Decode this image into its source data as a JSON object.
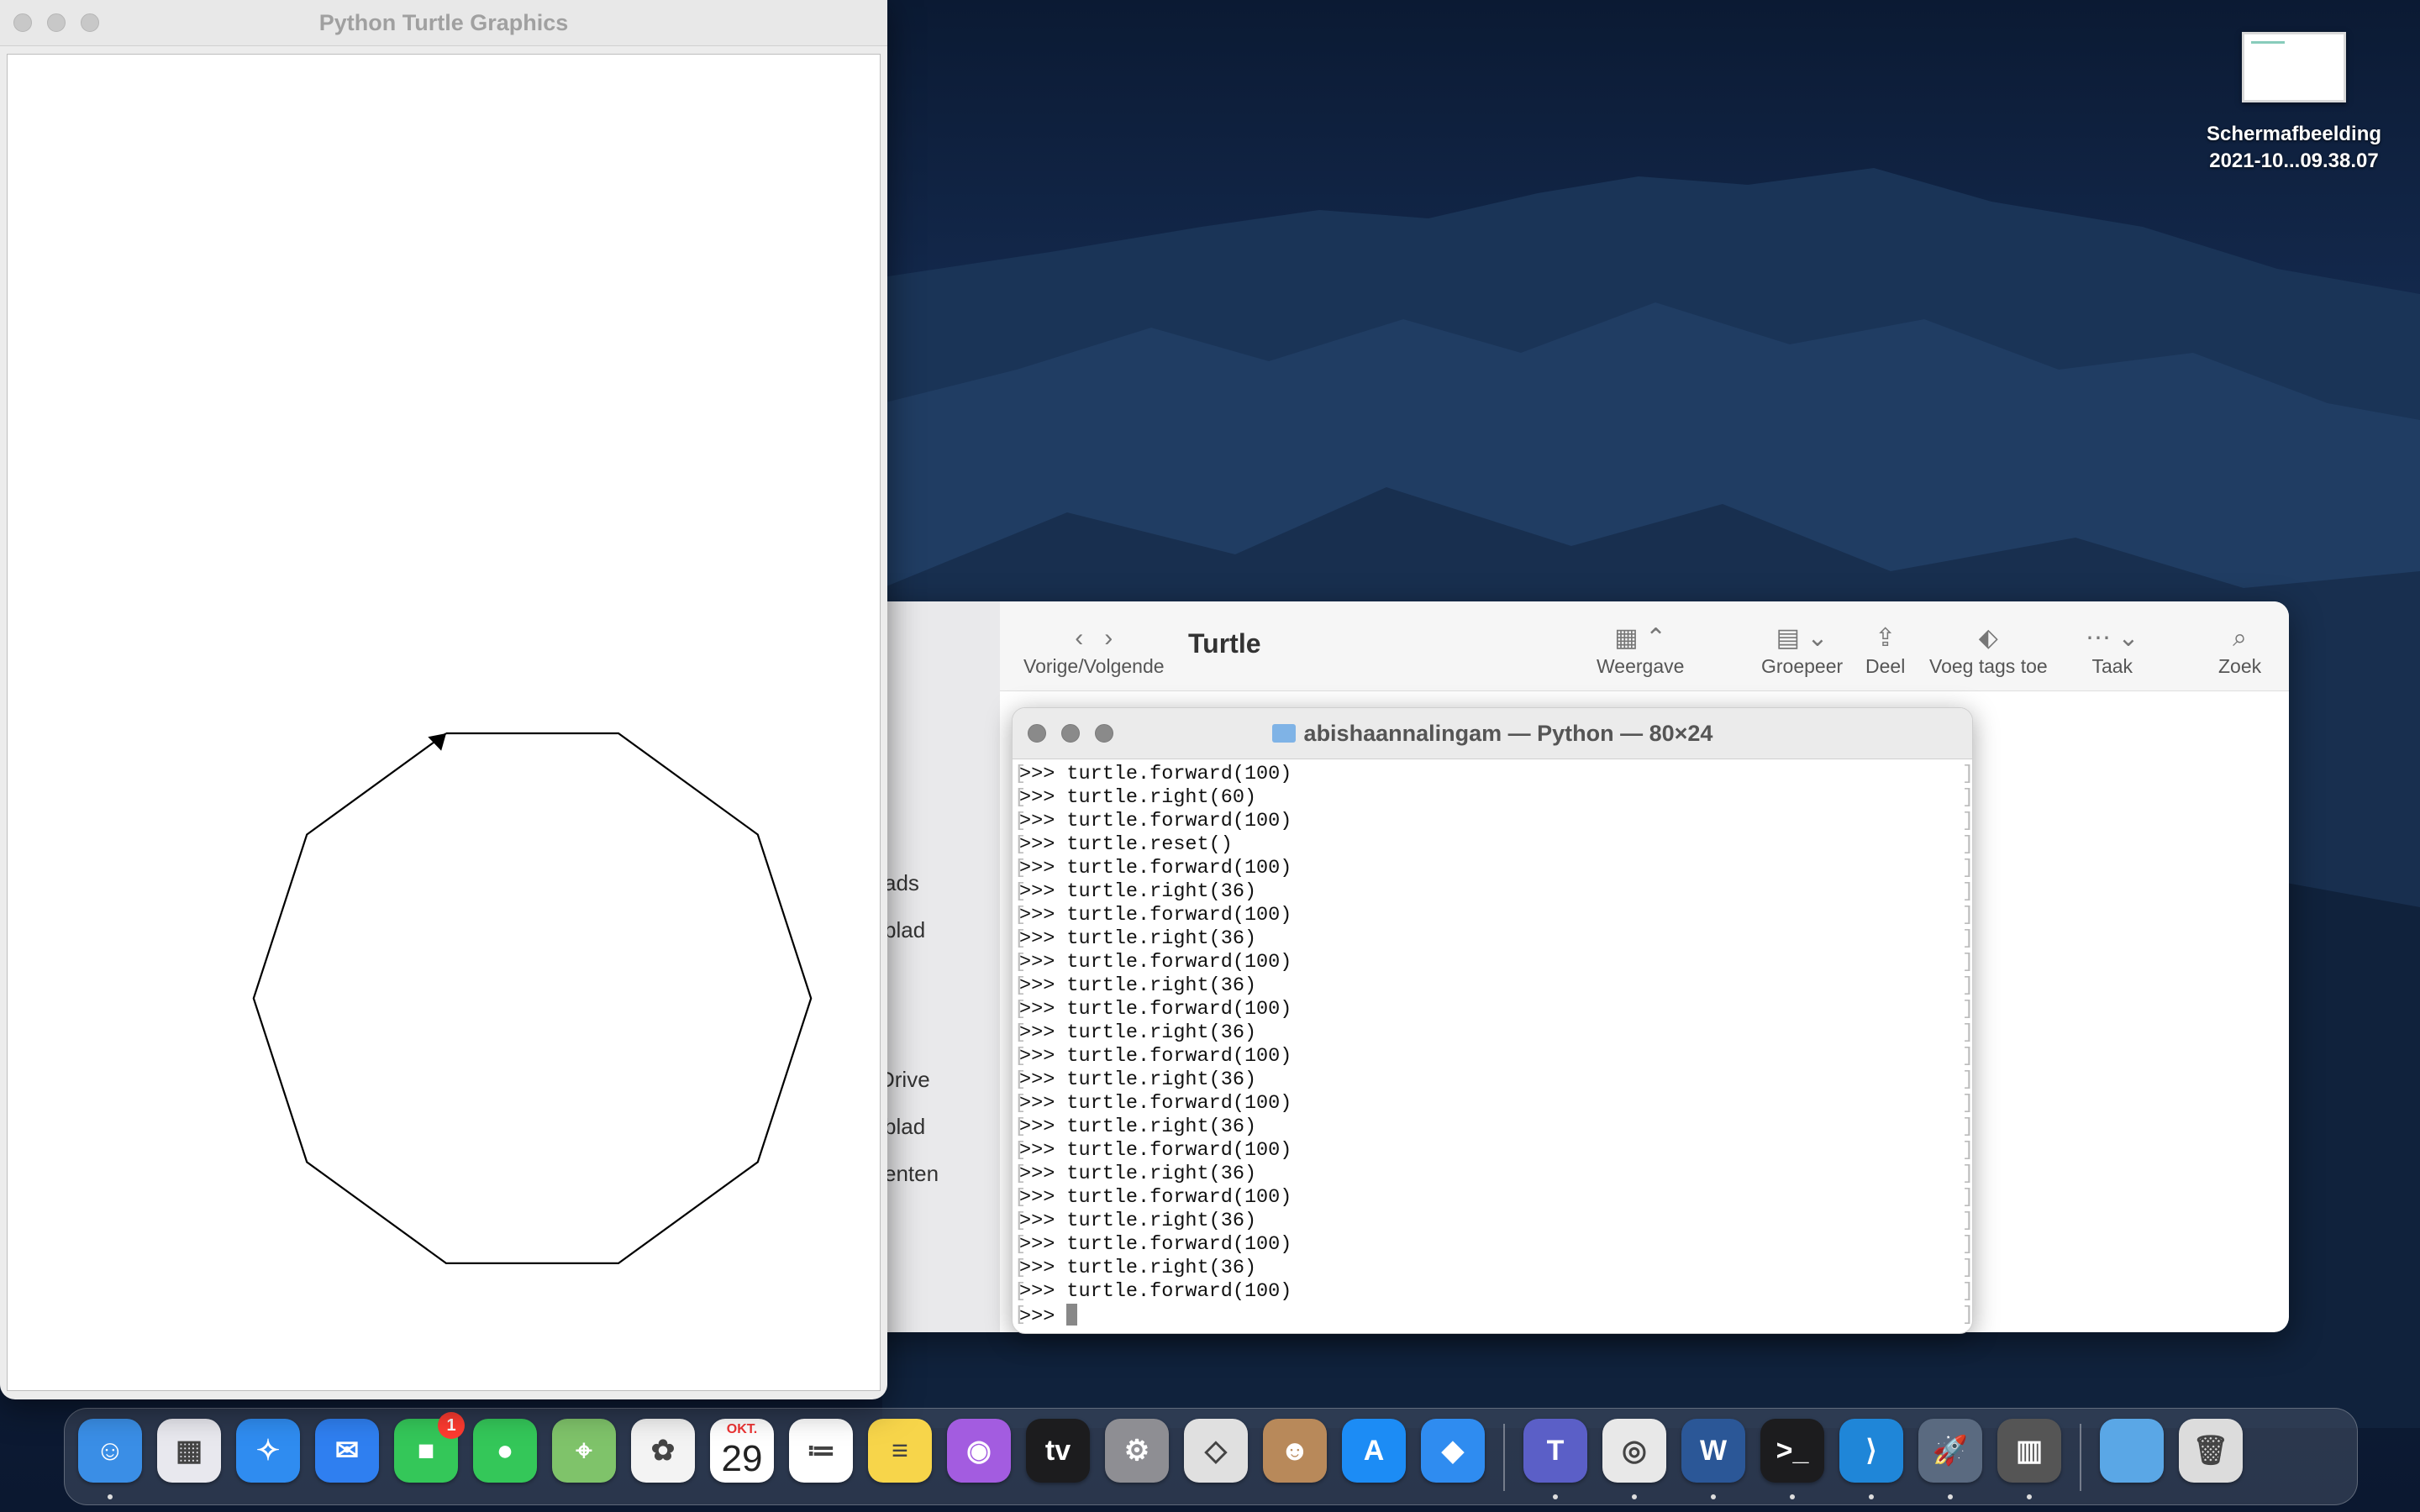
{
  "desktop": {
    "file_name_line1": "Schermafbeelding",
    "file_name_line2": "2021-10...09.38.07"
  },
  "turtle_window": {
    "title": "Python Turtle Graphics",
    "drawing": {
      "shape": "decagon",
      "sides": 10,
      "side_length": 100,
      "turn_angle": 36,
      "stroke": "#000000"
    }
  },
  "finder": {
    "title": "Turtle",
    "nav_label": "Vorige/Volgende",
    "toolbar": [
      {
        "icon": "grid-view-icon",
        "glyph": "▦ ⌃",
        "label": "Weergave"
      },
      {
        "icon": "group-icon",
        "glyph": "▤ ⌄",
        "label": "Groepeer"
      },
      {
        "icon": "share-icon",
        "glyph": "⇪",
        "label": "Deel"
      },
      {
        "icon": "tag-icon",
        "glyph": "⬖",
        "label": "Voeg tags toe"
      },
      {
        "icon": "action-icon",
        "glyph": "⋯ ⌄",
        "label": "Taak"
      },
      {
        "icon": "search-icon",
        "glyph": "⌕",
        "label": "Zoek"
      }
    ],
    "sidebar_items": [
      "ads",
      "blad",
      "Drive",
      "blad",
      "enten"
    ]
  },
  "terminal": {
    "title": "abishaannalingam — Python — 80×24",
    "lines": [
      ">>> turtle.forward(100)",
      ">>> turtle.right(60)",
      ">>> turtle.forward(100)",
      ">>> turtle.reset()",
      ">>> turtle.forward(100)",
      ">>> turtle.right(36)",
      ">>> turtle.forward(100)",
      ">>> turtle.right(36)",
      ">>> turtle.forward(100)",
      ">>> turtle.right(36)",
      ">>> turtle.forward(100)",
      ">>> turtle.right(36)",
      ">>> turtle.forward(100)",
      ">>> turtle.right(36)",
      ">>> turtle.forward(100)",
      ">>> turtle.right(36)",
      ">>> turtle.forward(100)",
      ">>> turtle.right(36)",
      ">>> turtle.forward(100)",
      ">>> turtle.right(36)",
      ">>> turtle.forward(100)",
      ">>> turtle.right(36)",
      ">>> turtle.forward(100)"
    ],
    "prompt": ">>> "
  },
  "dock": {
    "apps": [
      {
        "name": "finder",
        "glyph": "☺",
        "color": "#3a8ee6",
        "running": true
      },
      {
        "name": "launchpad",
        "glyph": "▦",
        "color": "#e8e8ee",
        "running": false
      },
      {
        "name": "safari",
        "glyph": "✧",
        "color": "#2f8cf0",
        "running": false
      },
      {
        "name": "mail",
        "glyph": "✉",
        "color": "#2f7ff0",
        "running": false
      },
      {
        "name": "facetime",
        "glyph": "■",
        "color": "#34c759",
        "running": false,
        "badge": "1"
      },
      {
        "name": "messages",
        "glyph": "●",
        "color": "#34c759",
        "running": false
      },
      {
        "name": "maps",
        "glyph": "⌖",
        "color": "#7fc36a",
        "running": false
      },
      {
        "name": "photos",
        "glyph": "✿",
        "color": "#f3f3f3",
        "running": false
      },
      {
        "name": "calendar",
        "glyph": "",
        "color": "#ffffff",
        "running": false,
        "month": "OKT.",
        "day": "29"
      },
      {
        "name": "reminders",
        "glyph": "≔",
        "color": "#ffffff",
        "running": false
      },
      {
        "name": "notes",
        "glyph": "≡",
        "color": "#f7d54a",
        "running": false
      },
      {
        "name": "podcasts",
        "glyph": "◉",
        "color": "#a35ce0",
        "running": false
      },
      {
        "name": "apple-tv",
        "glyph": "tv",
        "color": "#1c1c1e",
        "running": false
      },
      {
        "name": "system-preferences",
        "glyph": "⚙",
        "color": "#8e8e93",
        "running": false
      },
      {
        "name": "roblox-studio",
        "glyph": "◇",
        "color": "#e0e0e0",
        "running": false
      },
      {
        "name": "contacts",
        "glyph": "☻",
        "color": "#b8895a",
        "running": false
      },
      {
        "name": "app-store",
        "glyph": "A",
        "color": "#1c8cf5",
        "running": false
      },
      {
        "name": "roblox",
        "glyph": "◆",
        "color": "#2f8cf0",
        "running": false
      },
      {
        "name": "teams",
        "glyph": "T",
        "color": "#5b5fc7",
        "running": true
      },
      {
        "name": "chrome",
        "glyph": "◎",
        "color": "#e8e8e8",
        "running": true
      },
      {
        "name": "word",
        "glyph": "W",
        "color": "#2b5797",
        "running": true
      },
      {
        "name": "terminal",
        "glyph": ">_",
        "color": "#1c1c1e",
        "running": true
      },
      {
        "name": "vscode",
        "glyph": "⟩",
        "color": "#1f86d8",
        "running": true
      },
      {
        "name": "python-launcher",
        "glyph": "🚀",
        "color": "#5a6a80",
        "running": true
      },
      {
        "name": "calculator",
        "glyph": "▥",
        "color": "#555555",
        "running": true
      },
      {
        "name": "downloads-folder",
        "glyph": "",
        "color": "#5aa7e6",
        "running": false
      },
      {
        "name": "trash",
        "glyph": "🗑",
        "color": "#dcdcdc",
        "running": false
      }
    ]
  }
}
